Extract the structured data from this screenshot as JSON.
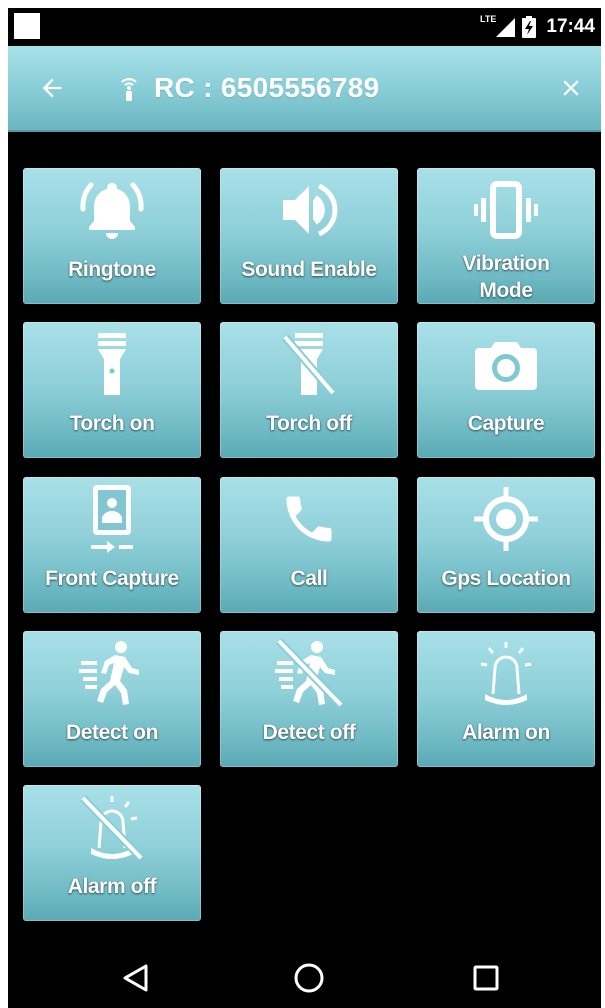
{
  "status_bar": {
    "network": "LTE",
    "time": "17:44"
  },
  "app_bar": {
    "title": "RC : 6505556789",
    "back_icon": "arrow-left-icon",
    "remote_icon": "remote-signal-icon",
    "close_icon": "close-icon"
  },
  "actions": [
    {
      "label": "Ringtone",
      "icon": "bell-ringing-icon"
    },
    {
      "label": "Sound Enable",
      "icon": "speaker-icon"
    },
    {
      "label": "Vibration Mode",
      "icon": "vibrate-icon"
    },
    {
      "label": "Torch on",
      "icon": "flashlight-icon"
    },
    {
      "label": "Torch off",
      "icon": "flashlight-off-icon"
    },
    {
      "label": "Capture",
      "icon": "camera-icon"
    },
    {
      "label": "Front Capture",
      "icon": "front-camera-icon"
    },
    {
      "label": "Call",
      "icon": "phone-icon"
    },
    {
      "label": "Gps Location",
      "icon": "gps-fixed-icon"
    },
    {
      "label": "Detect on",
      "icon": "running-person-icon"
    },
    {
      "label": "Detect off",
      "icon": "running-person-off-icon"
    },
    {
      "label": "Alarm on",
      "icon": "siren-icon"
    },
    {
      "label": "Alarm off",
      "icon": "siren-off-icon"
    }
  ],
  "nav_bar": {
    "back": "nav-back-icon",
    "home": "nav-home-icon",
    "recents": "nav-recents-icon"
  },
  "colors": {
    "accent": "#8fd0d9",
    "app_bar": "#86ccd6",
    "background": "#000000",
    "text": "#ffffff"
  }
}
